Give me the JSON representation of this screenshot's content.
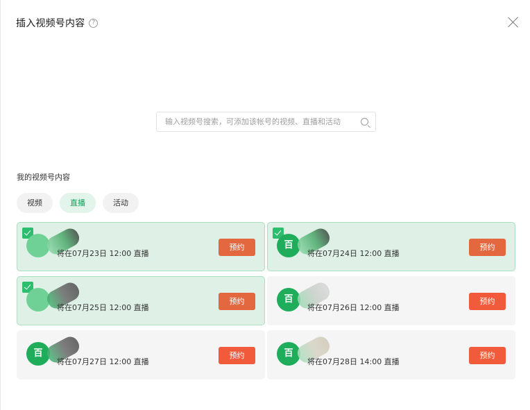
{
  "dialog": {
    "title": "插入视频号内容",
    "help_icon": "question-circle-icon",
    "close_icon": "close-icon"
  },
  "search": {
    "placeholder": "输入视频号搜索，可添加该帐号的视频、直播和活动"
  },
  "section_label": "我的视频号内容",
  "tabs": [
    {
      "label": "视频",
      "active": false
    },
    {
      "label": "直播",
      "active": true
    },
    {
      "label": "活动",
      "active": false
    }
  ],
  "cards": [
    {
      "time": "将在07月23日 12:00 直播",
      "button": "预约",
      "selected": true,
      "avatar_text": "",
      "smudge": "a"
    },
    {
      "time": "将在07月24日 12:00 直播",
      "button": "预约",
      "selected": true,
      "avatar_text": "百",
      "smudge": "a"
    },
    {
      "time": "将在07月25日 12:00 直播",
      "button": "预约",
      "selected": true,
      "avatar_text": "",
      "smudge": "c"
    },
    {
      "time": "将在07月26日 12:00 直播",
      "button": "预约",
      "selected": false,
      "avatar_text": "百",
      "smudge": "b"
    },
    {
      "time": "将在07月27日 12:00 直播",
      "button": "预约",
      "selected": false,
      "avatar_text": "百",
      "smudge": "c"
    },
    {
      "time": "将在07月28日 14:00 直播",
      "button": "预约",
      "selected": false,
      "avatar_text": "百",
      "smudge": "d"
    }
  ],
  "colors": {
    "accent_green": "#07a455",
    "selected_bg": "#dff1e6",
    "reserve_button": "#f15b3b"
  }
}
